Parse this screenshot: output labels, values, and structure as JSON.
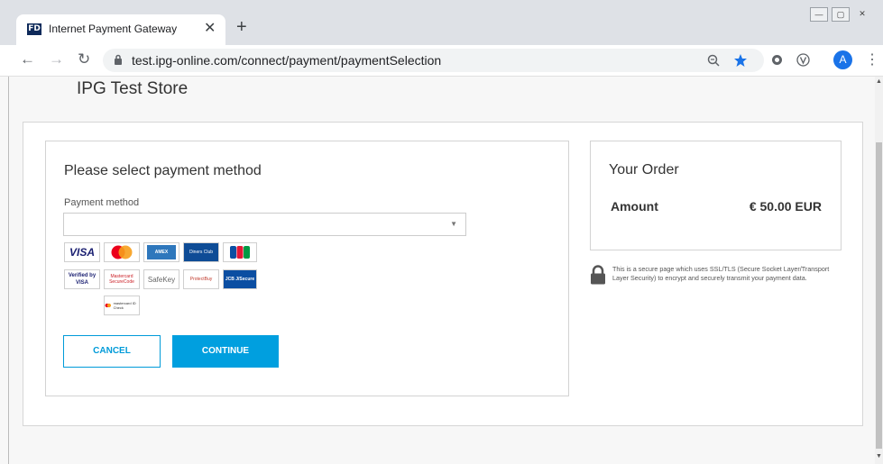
{
  "browser": {
    "tab": {
      "favicon_text": "FD",
      "title": "Internet Payment Gateway",
      "close_glyph": "✕"
    },
    "new_tab_glyph": "+",
    "window_controls": {
      "minimize": "—",
      "maximize": "▢",
      "close": "✕"
    },
    "nav": {
      "back": "←",
      "forward": "→",
      "reload": "↻"
    },
    "url": "test.ipg-online.com/connect/payment/paymentSelection",
    "icons": [
      "zoom-icon",
      "bookmark-star-icon",
      "extension-circle-icon",
      "extension-v-icon"
    ],
    "avatar_letter": "A",
    "menu_glyph": "⋮",
    "accent_color": "#1a73e8"
  },
  "page": {
    "store_name": "IPG Test Store",
    "payment_section": {
      "heading": "Please select payment method",
      "method_label": "Payment method",
      "selected_value": "",
      "cards": [
        {
          "name": "visa",
          "text": "VISA"
        },
        {
          "name": "mastercard",
          "text": ""
        },
        {
          "name": "amex",
          "text": "AMEX"
        },
        {
          "name": "diners-club",
          "text": "Diners Club"
        },
        {
          "name": "jcb",
          "text": "JCB"
        },
        {
          "name": "verified-by-visa",
          "text": "Verified by VISA"
        },
        {
          "name": "mastercard-securecode",
          "text": "Mastercard SecureCode"
        },
        {
          "name": "safekey",
          "text": "SafeKey"
        },
        {
          "name": "protectbuy",
          "text": "ProtectBuy"
        },
        {
          "name": "jcb-jsecure",
          "text": "JCB J/Secure"
        },
        {
          "name": "mastercard-idcheck",
          "text": "mastercard ID Check"
        }
      ],
      "cancel_label": "CANCEL",
      "continue_label": "CONTINUE",
      "button_color": "#009fdf"
    },
    "order": {
      "heading": "Your Order",
      "amount_label": "Amount",
      "amount_value": "€ 50.00 EUR"
    },
    "security_note": "This is a secure page which uses SSL/TLS (Secure Socket Layer/Transport Layer Security) to encrypt and securely transmit your payment data."
  }
}
